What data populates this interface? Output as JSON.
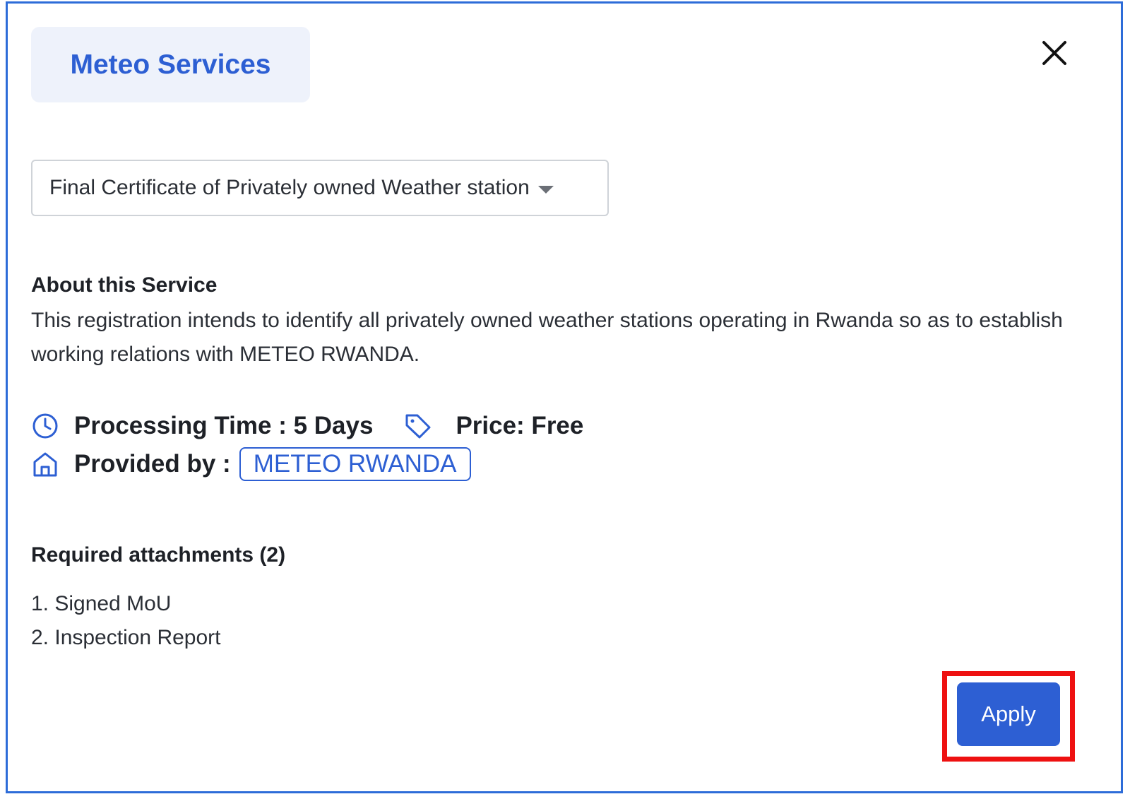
{
  "header": {
    "category": "Meteo Services",
    "close_icon": "close-icon"
  },
  "service_select": {
    "selected": "Final Certificate of Privately owned Weather station",
    "caret_icon": "chevron-down-icon"
  },
  "about": {
    "title": "About this Service",
    "text": "This registration intends to identify all privately owned weather stations operating in Rwanda so as to establish working relations with METEO RWANDA."
  },
  "info": {
    "processing_icon": "clock-icon",
    "processing_time": "Processing Time : 5 Days",
    "price_icon": "tag-icon",
    "price": "Price: Free",
    "provider_icon": "home-icon",
    "provided_by_label": "Provided by :",
    "provider": "METEO RWANDA"
  },
  "attachments": {
    "title": "Required attachments (2)",
    "items": [
      "1. Signed MoU",
      "2. Inspection Report"
    ]
  },
  "actions": {
    "apply_label": "Apply"
  },
  "colors": {
    "accent": "#2d5fd3",
    "highlight": "#ee1111",
    "badge_bg": "#eef2fb"
  }
}
